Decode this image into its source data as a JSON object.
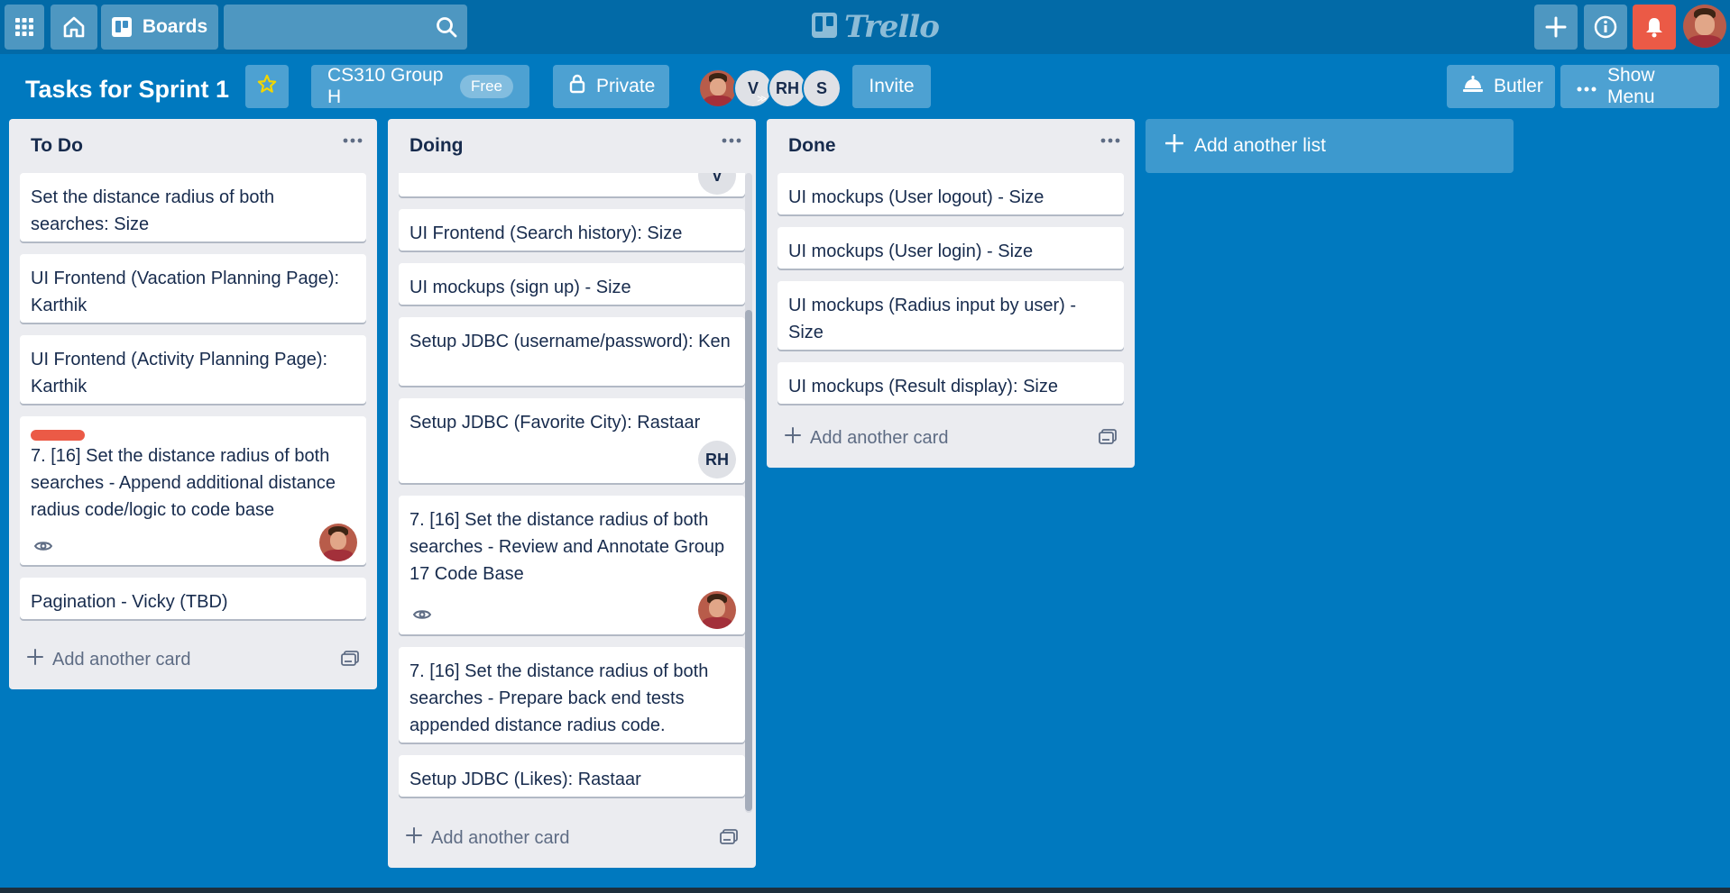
{
  "header": {
    "boards_label": "Boards",
    "search_placeholder": "",
    "logo_text": "Trello"
  },
  "board": {
    "title": "Tasks for Sprint 1",
    "team_name": "CS310 Group H",
    "team_badge": "Free",
    "visibility": "Private",
    "members": [
      "V",
      "RH",
      "S"
    ],
    "invite_label": "Invite",
    "butler_label": "Butler",
    "show_menu_label": "Show Menu"
  },
  "lists": [
    {
      "title": "To Do",
      "add_card_label": "Add another card",
      "cards": [
        {
          "title": "Set the distance radius of both searches: Size"
        },
        {
          "title": "UI Frontend (Vacation Planning Page): Karthik"
        },
        {
          "title": "UI Frontend (Activity Planning Page): Karthik"
        },
        {
          "title": "7. [16] Set the distance radius of both searches - Append additional distance radius code/logic to code base",
          "label_color": "#eb5a46",
          "watching": true,
          "member": "photo"
        },
        {
          "title": "Pagination - Vicky (TBD)"
        }
      ]
    },
    {
      "title": "Doing",
      "add_card_label": "Add another card",
      "cards": [
        {
          "title": "",
          "member": "V"
        },
        {
          "title": "UI Frontend (Search history): Size"
        },
        {
          "title": "UI mockups (sign up) - Size"
        },
        {
          "title": "Setup JDBC (username/password): Ken"
        },
        {
          "title": "Setup JDBC (Favorite City): Rastaar",
          "member": "RH"
        },
        {
          "title": "7. [16] Set the distance radius of both searches - Review and Annotate Group 17 Code Base",
          "watching": true,
          "member": "photo"
        },
        {
          "title": "7. [16] Set the distance radius of both searches - Prepare back end tests appended distance radius code."
        },
        {
          "title": "Setup JDBC (Likes): Rastaar"
        }
      ]
    },
    {
      "title": "Done",
      "add_card_label": "Add another card",
      "cards": [
        {
          "title": "UI mockups (User logout) - Size"
        },
        {
          "title": "UI mockups (User login) - Size"
        },
        {
          "title": "UI mockups (Radius input by user) - Size"
        },
        {
          "title": "UI mockups (Result display): Size"
        }
      ]
    }
  ],
  "add_list_label": "Add another list",
  "colors": {
    "board_background": "#0079bf",
    "header_background": "#026aa7",
    "list_background": "#ebecf0",
    "label_red": "#eb5a46",
    "notification": "#eb5a46",
    "star": "#f2d600"
  }
}
